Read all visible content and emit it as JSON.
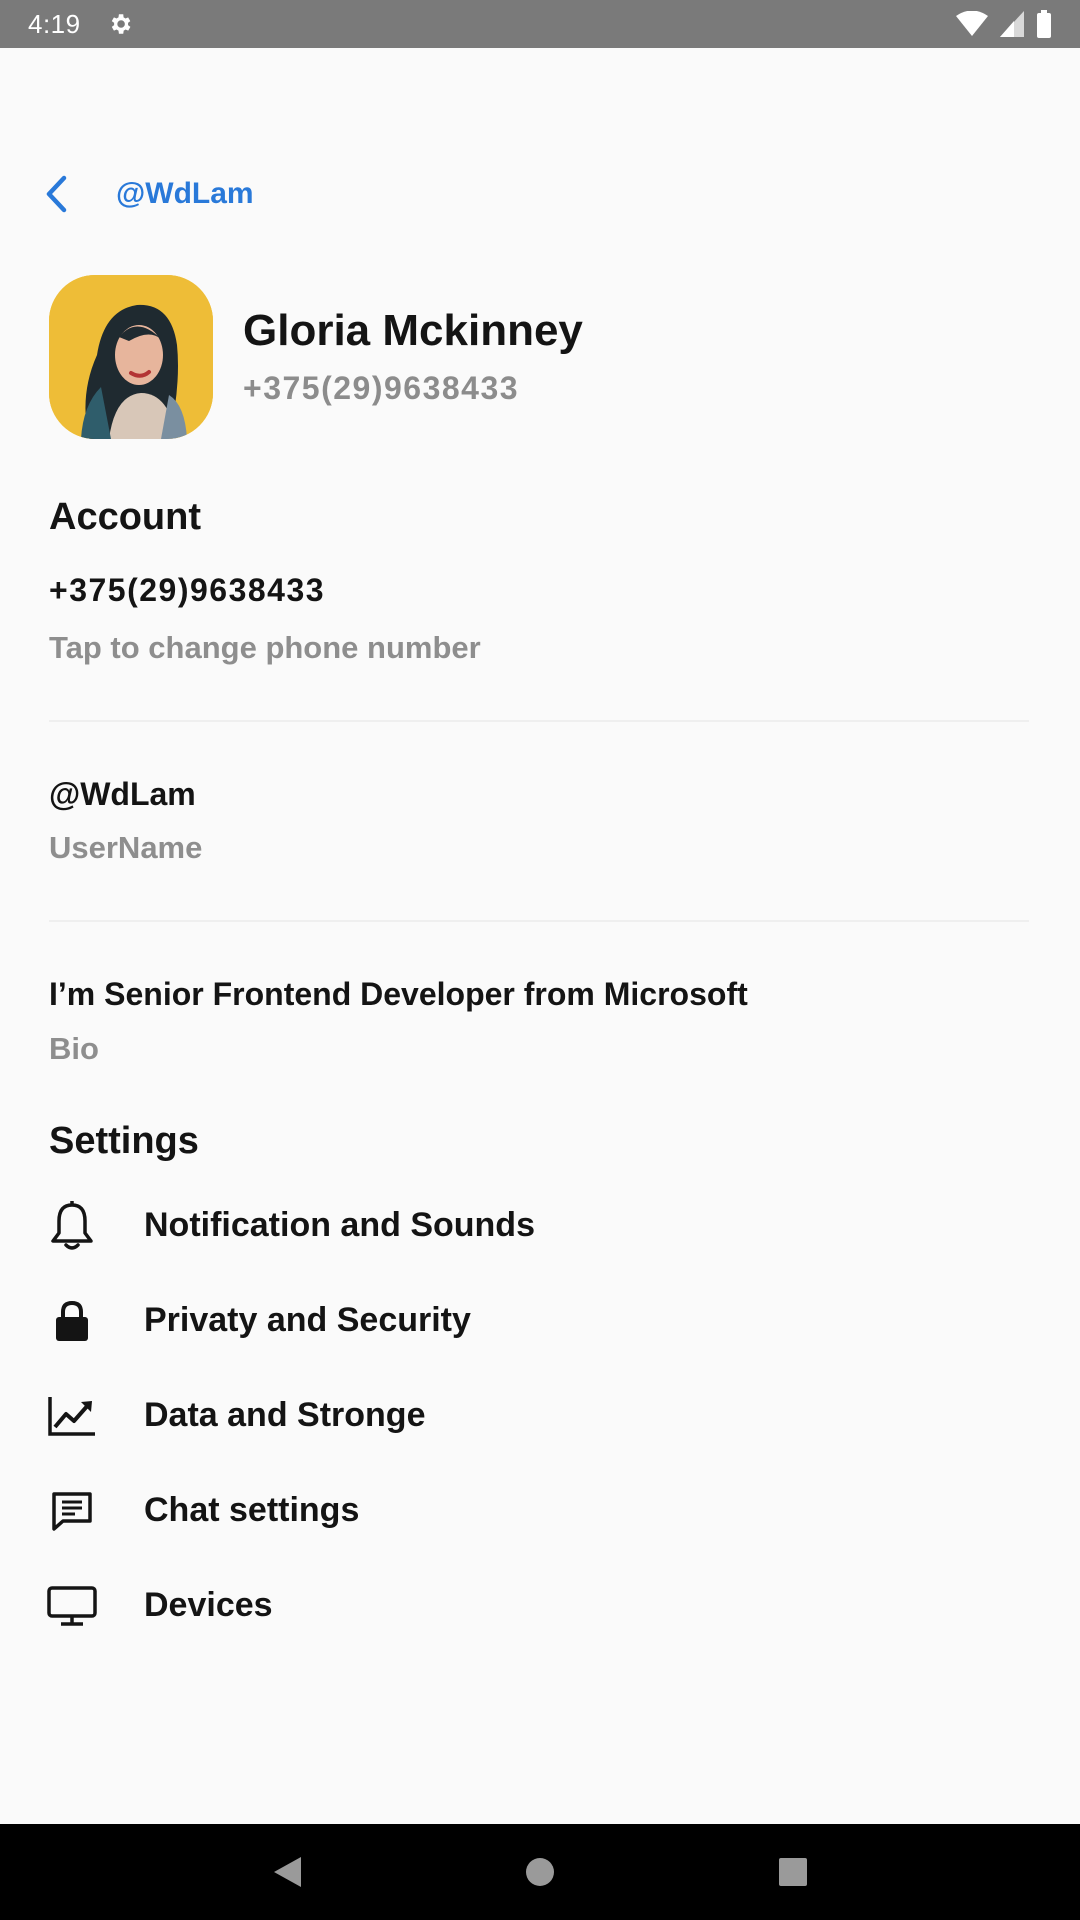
{
  "status_bar": {
    "time": "4:19"
  },
  "header": {
    "handle": "@WdLam"
  },
  "profile": {
    "name": "Gloria Mckinney",
    "phone": "+375(29)9638433"
  },
  "account": {
    "title": "Account",
    "phone_value": "+375(29)9638433",
    "phone_hint": "Tap to change phone number",
    "username_value": "@WdLam",
    "username_label": "UserName",
    "bio_value": "I’m Senior Frontend Developer from Microsoft",
    "bio_label": "Bio"
  },
  "settings": {
    "title": "Settings",
    "items": [
      {
        "label": "Notification and Sounds",
        "icon": "bell-icon"
      },
      {
        "label": "Privaty and Security",
        "icon": "lock-icon"
      },
      {
        "label": "Data and Stronge",
        "icon": "chart-icon"
      },
      {
        "label": "Chat settings",
        "icon": "chat-icon"
      },
      {
        "label": "Devices",
        "icon": "monitor-icon"
      }
    ]
  },
  "colors": {
    "accent": "#2979d9",
    "background": "#fafafa",
    "muted_text": "#8c8c8c",
    "status_bar": "#7a7a7a",
    "nav_bar": "#000000",
    "avatar_bg": "#f2c23c"
  }
}
